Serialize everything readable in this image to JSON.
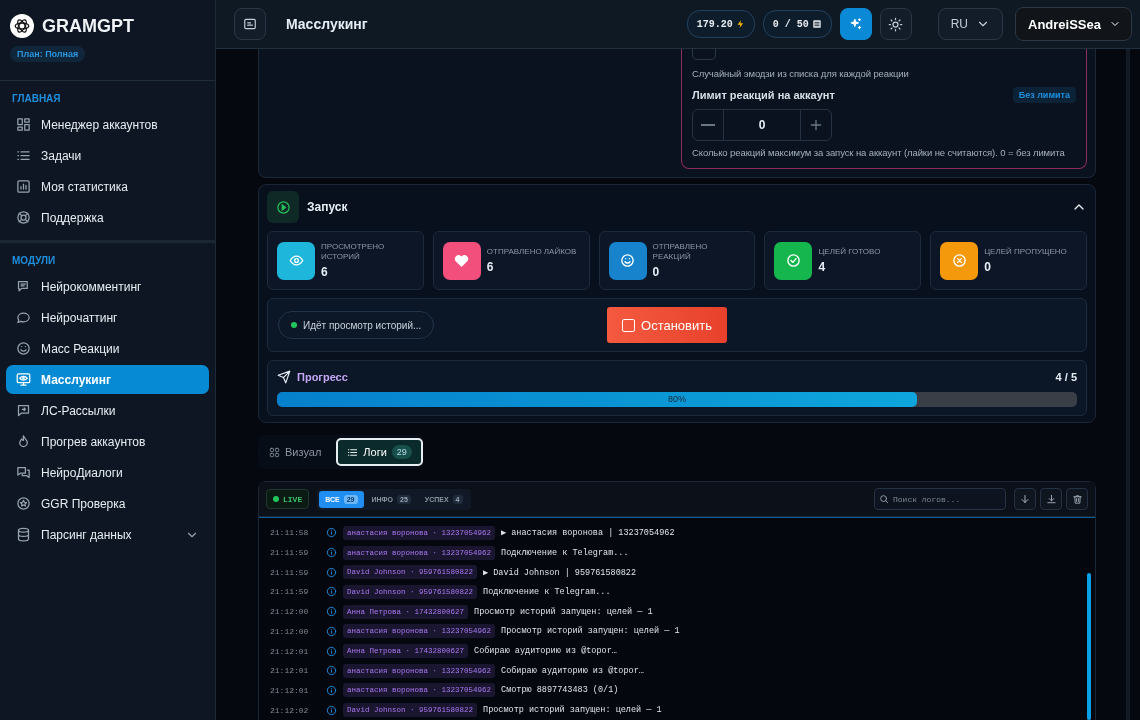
{
  "sidebar": {
    "brand": "GRAMGPT",
    "plan": "План: Полная",
    "sections": [
      {
        "title": "ГЛАВНАЯ",
        "items": [
          {
            "label": "Менеджер аккаунтов",
            "selected": false
          },
          {
            "label": "Задачи",
            "selected": false
          },
          {
            "label": "Моя статистика",
            "selected": false
          },
          {
            "label": "Поддержка",
            "selected": false
          }
        ]
      },
      {
        "title": "МОДУЛИ",
        "items": [
          {
            "label": "Нейрокомментинг",
            "selected": false
          },
          {
            "label": "Нейрочаттинг",
            "selected": false
          },
          {
            "label": "Масс Реакции",
            "selected": false
          },
          {
            "label": "Масслукинг",
            "selected": true
          },
          {
            "label": "ЛС-Рассылки",
            "selected": false
          },
          {
            "label": "Прогрев аккаунтов",
            "selected": false
          },
          {
            "label": "НейроДиалоги",
            "selected": false
          },
          {
            "label": "GGR Проверка",
            "selected": false
          },
          {
            "label": "Парсинг данных",
            "selected": false,
            "expanded": false
          }
        ]
      }
    ]
  },
  "header": {
    "title": "Масслукинг",
    "balance": "179.20",
    "quota": "0 / 50",
    "language": "RU",
    "user": "AndreiSSea"
  },
  "reactions": {
    "emoji_hint": "Случайный эмодзи из списка для каждой реакции",
    "limit_label": "Лимит реакций на аккаунт",
    "limit_badge": "Без лимита",
    "limit_value": "0",
    "limit_help": "Сколько реакций максимум за запуск на аккаунт (лайки не считаются). 0 = без лимита"
  },
  "launch": {
    "title": "Запуск",
    "expanded": true,
    "stats": [
      {
        "label": "ПРОСМОТРЕНО ИСТОРИЙ",
        "value": "6",
        "color": "#1eb6da"
      },
      {
        "label": "ОТПРАВЛЕНО ЛАЙКОВ",
        "value": "6",
        "color": "#f24f7c"
      },
      {
        "label": "ОТПРАВЛЕНО РЕАКЦИЙ",
        "value": "0",
        "color": "#1683cc"
      },
      {
        "label": "ЦЕЛЕЙ ГОТОВО",
        "value": "4",
        "color": "#16b64e"
      },
      {
        "label": "ЦЕЛЕЙ ПРОПУЩЕНО",
        "value": "0",
        "color": "#f4980c"
      }
    ],
    "status": "Идёт просмотр историй...",
    "stop_button": "Остановить",
    "progress": {
      "title": "Прогресс",
      "count": "4 / 5",
      "level": 0.8,
      "label": "80%"
    }
  },
  "view_tabs": [
    {
      "label": "Визуал",
      "selected": false
    },
    {
      "label": "Логи",
      "count": "29",
      "selected": true
    }
  ],
  "logs": {
    "live": "LIVE",
    "filters": [
      {
        "label": "ВСЕ",
        "count": "29",
        "selected": true
      },
      {
        "label": "ИНФО",
        "count": "25",
        "selected": false
      },
      {
        "label": "УСПЕХ",
        "count": "4",
        "selected": false
      }
    ],
    "search_placeholder": "Поиск логов...",
    "rows": [
      {
        "time": "21:11:58",
        "kind": "info",
        "source": "анастасия воронова · 13237054962",
        "message": "▶ анастасия воронова | 13237054962"
      },
      {
        "time": "21:11:59",
        "kind": "info",
        "source": "анастасия воронова · 13237054962",
        "message": "Подключение к Telegram..."
      },
      {
        "time": "21:11:59",
        "kind": "info",
        "source": "David Johnson · 959761580822",
        "message": "▶ David Johnson | 959761580822"
      },
      {
        "time": "21:11:59",
        "kind": "info",
        "source": "David Johnson · 959761580822",
        "message": "Подключение к Telegram..."
      },
      {
        "time": "21:12:00",
        "kind": "info",
        "source": "Анна Петрова · 17432800627",
        "message": "Просмотр историй запущен: целей — 1"
      },
      {
        "time": "21:12:00",
        "kind": "info",
        "source": "анастасия воронова · 13237054962",
        "message": "Просмотр историй запущен: целей — 1"
      },
      {
        "time": "21:12:01",
        "kind": "info",
        "source": "Анна Петрова · 17432800627",
        "message": "Собираю аудиторию из @topor…"
      },
      {
        "time": "21:12:01",
        "kind": "info",
        "source": "анастасия воронова · 13237054962",
        "message": "Собираю аудиторию из @topor…"
      },
      {
        "time": "21:12:01",
        "kind": "info",
        "source": "анастасия воронова · 13237054962",
        "message": "Смотрю 8897743483 (0/1)"
      },
      {
        "time": "21:12:02",
        "kind": "info",
        "source": "David Johnson · 959761580822",
        "message": "Просмотр историй запущен: целей — 1"
      }
    ]
  }
}
